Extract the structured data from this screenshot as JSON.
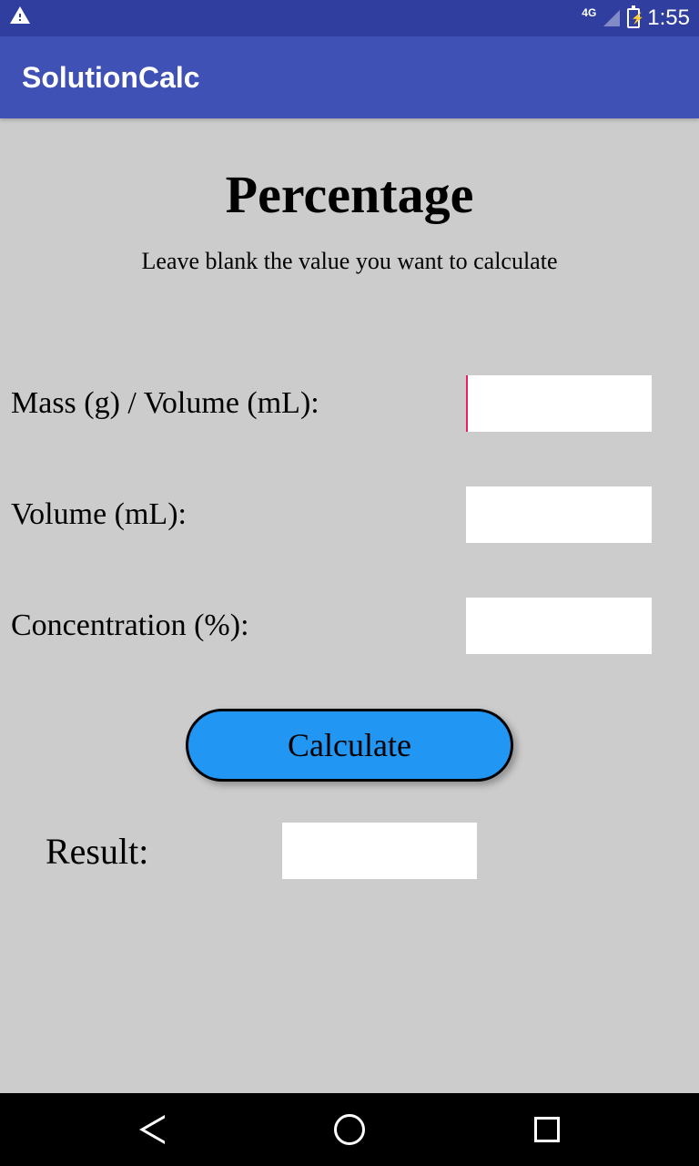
{
  "status_bar": {
    "network": "4G",
    "time": "1:55"
  },
  "app_bar": {
    "title": "SolutionCalc"
  },
  "page": {
    "title": "Percentage",
    "subtitle": "Leave blank the value you want to calculate"
  },
  "form": {
    "mass_label": "Mass (g) / Volume (mL):",
    "mass_value": "",
    "volume_label": "Volume (mL):",
    "volume_value": "",
    "concentration_label": "Concentration (%):",
    "concentration_value": "",
    "calculate_button": "Calculate",
    "result_label": "Result:",
    "result_value": ""
  }
}
